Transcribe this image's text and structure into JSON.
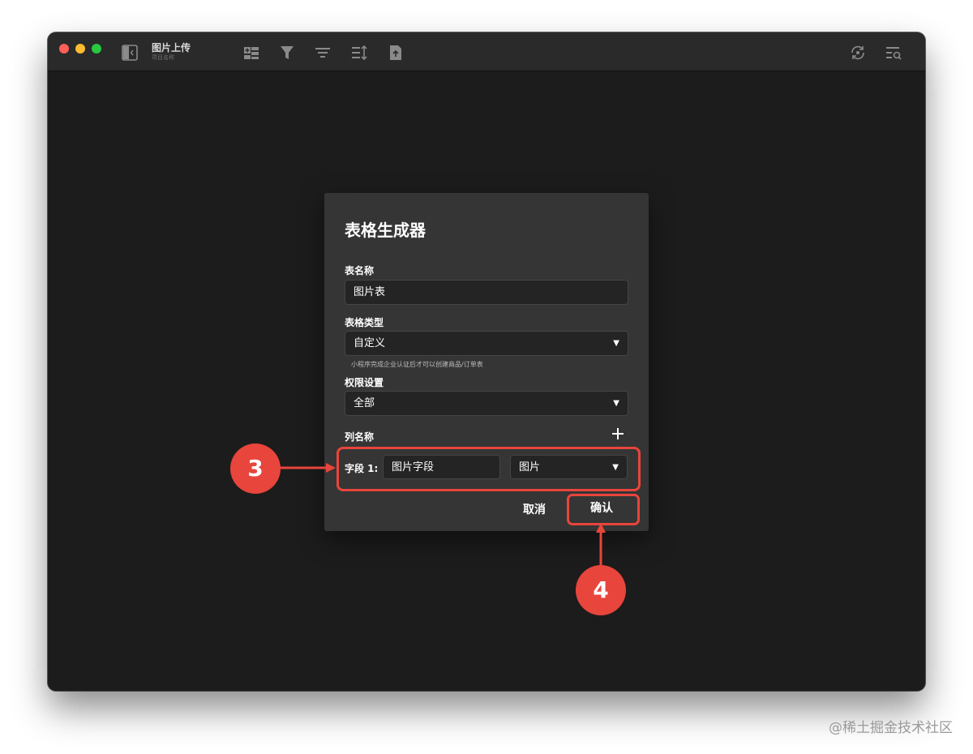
{
  "window": {
    "title": "图片上传",
    "subtitle": "项目名称",
    "toolbar_icons": [
      "sidebar-toggle-icon",
      "add-record-icon",
      "filter-icon",
      "group-icon",
      "sort-icon",
      "upload-icon",
      "sync-icon",
      "search-list-icon"
    ]
  },
  "dialog": {
    "title": "表格生成器",
    "table_name_label": "表名称",
    "table_name_value": "图片表",
    "table_type_label": "表格类型",
    "table_type_value": "自定义",
    "table_type_hint": "小程序完成企业认证后才可以创建商品/订单表",
    "permission_label": "权限设置",
    "permission_value": "全部",
    "columns_label": "列名称",
    "field_label": "字段 1:",
    "field_name_value": "图片字段",
    "field_type_value": "图片",
    "cancel_label": "取消",
    "confirm_label": "确认"
  },
  "annotations": {
    "step3": "3",
    "step4": "4",
    "color": "#e8453c"
  },
  "watermark": "@稀土掘金技术社区"
}
